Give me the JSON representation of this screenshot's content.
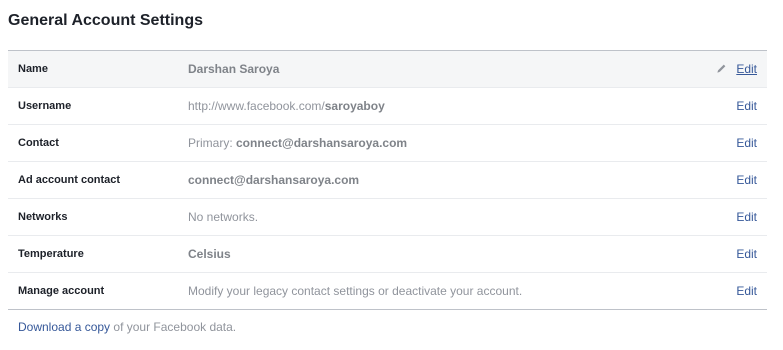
{
  "page": {
    "title": "General Account Settings"
  },
  "rows": [
    {
      "label": "Name",
      "value_bold": "Darshan Saroya",
      "edit_label": "Edit",
      "edit_icon": "pencil-icon"
    },
    {
      "label": "Username",
      "value_prefix": "http://www.facebook.com/",
      "value_bold": "saroyaboy",
      "edit_label": "Edit"
    },
    {
      "label": "Contact",
      "value_prefix": "Primary: ",
      "value_bold": "connect@darshansaroya.com",
      "edit_label": "Edit"
    },
    {
      "label": "Ad account contact",
      "value_bold": "connect@darshansaroya.com",
      "edit_label": "Edit"
    },
    {
      "label": "Networks",
      "value_prefix": "No networks.",
      "edit_label": "Edit"
    },
    {
      "label": "Temperature",
      "value_bold": "Celsius",
      "edit_label": "Edit"
    },
    {
      "label": "Manage account",
      "value_prefix": "Modify your legacy contact settings or deactivate your account.",
      "edit_label": "Edit"
    }
  ],
  "footer": {
    "link_text": "Download a copy",
    "suffix_text": " of your Facebook data."
  },
  "colors": {
    "link": "#365899",
    "muted_text": "#90949c",
    "header_row_bg": "#f5f6f7",
    "border": "#bec2c9"
  }
}
